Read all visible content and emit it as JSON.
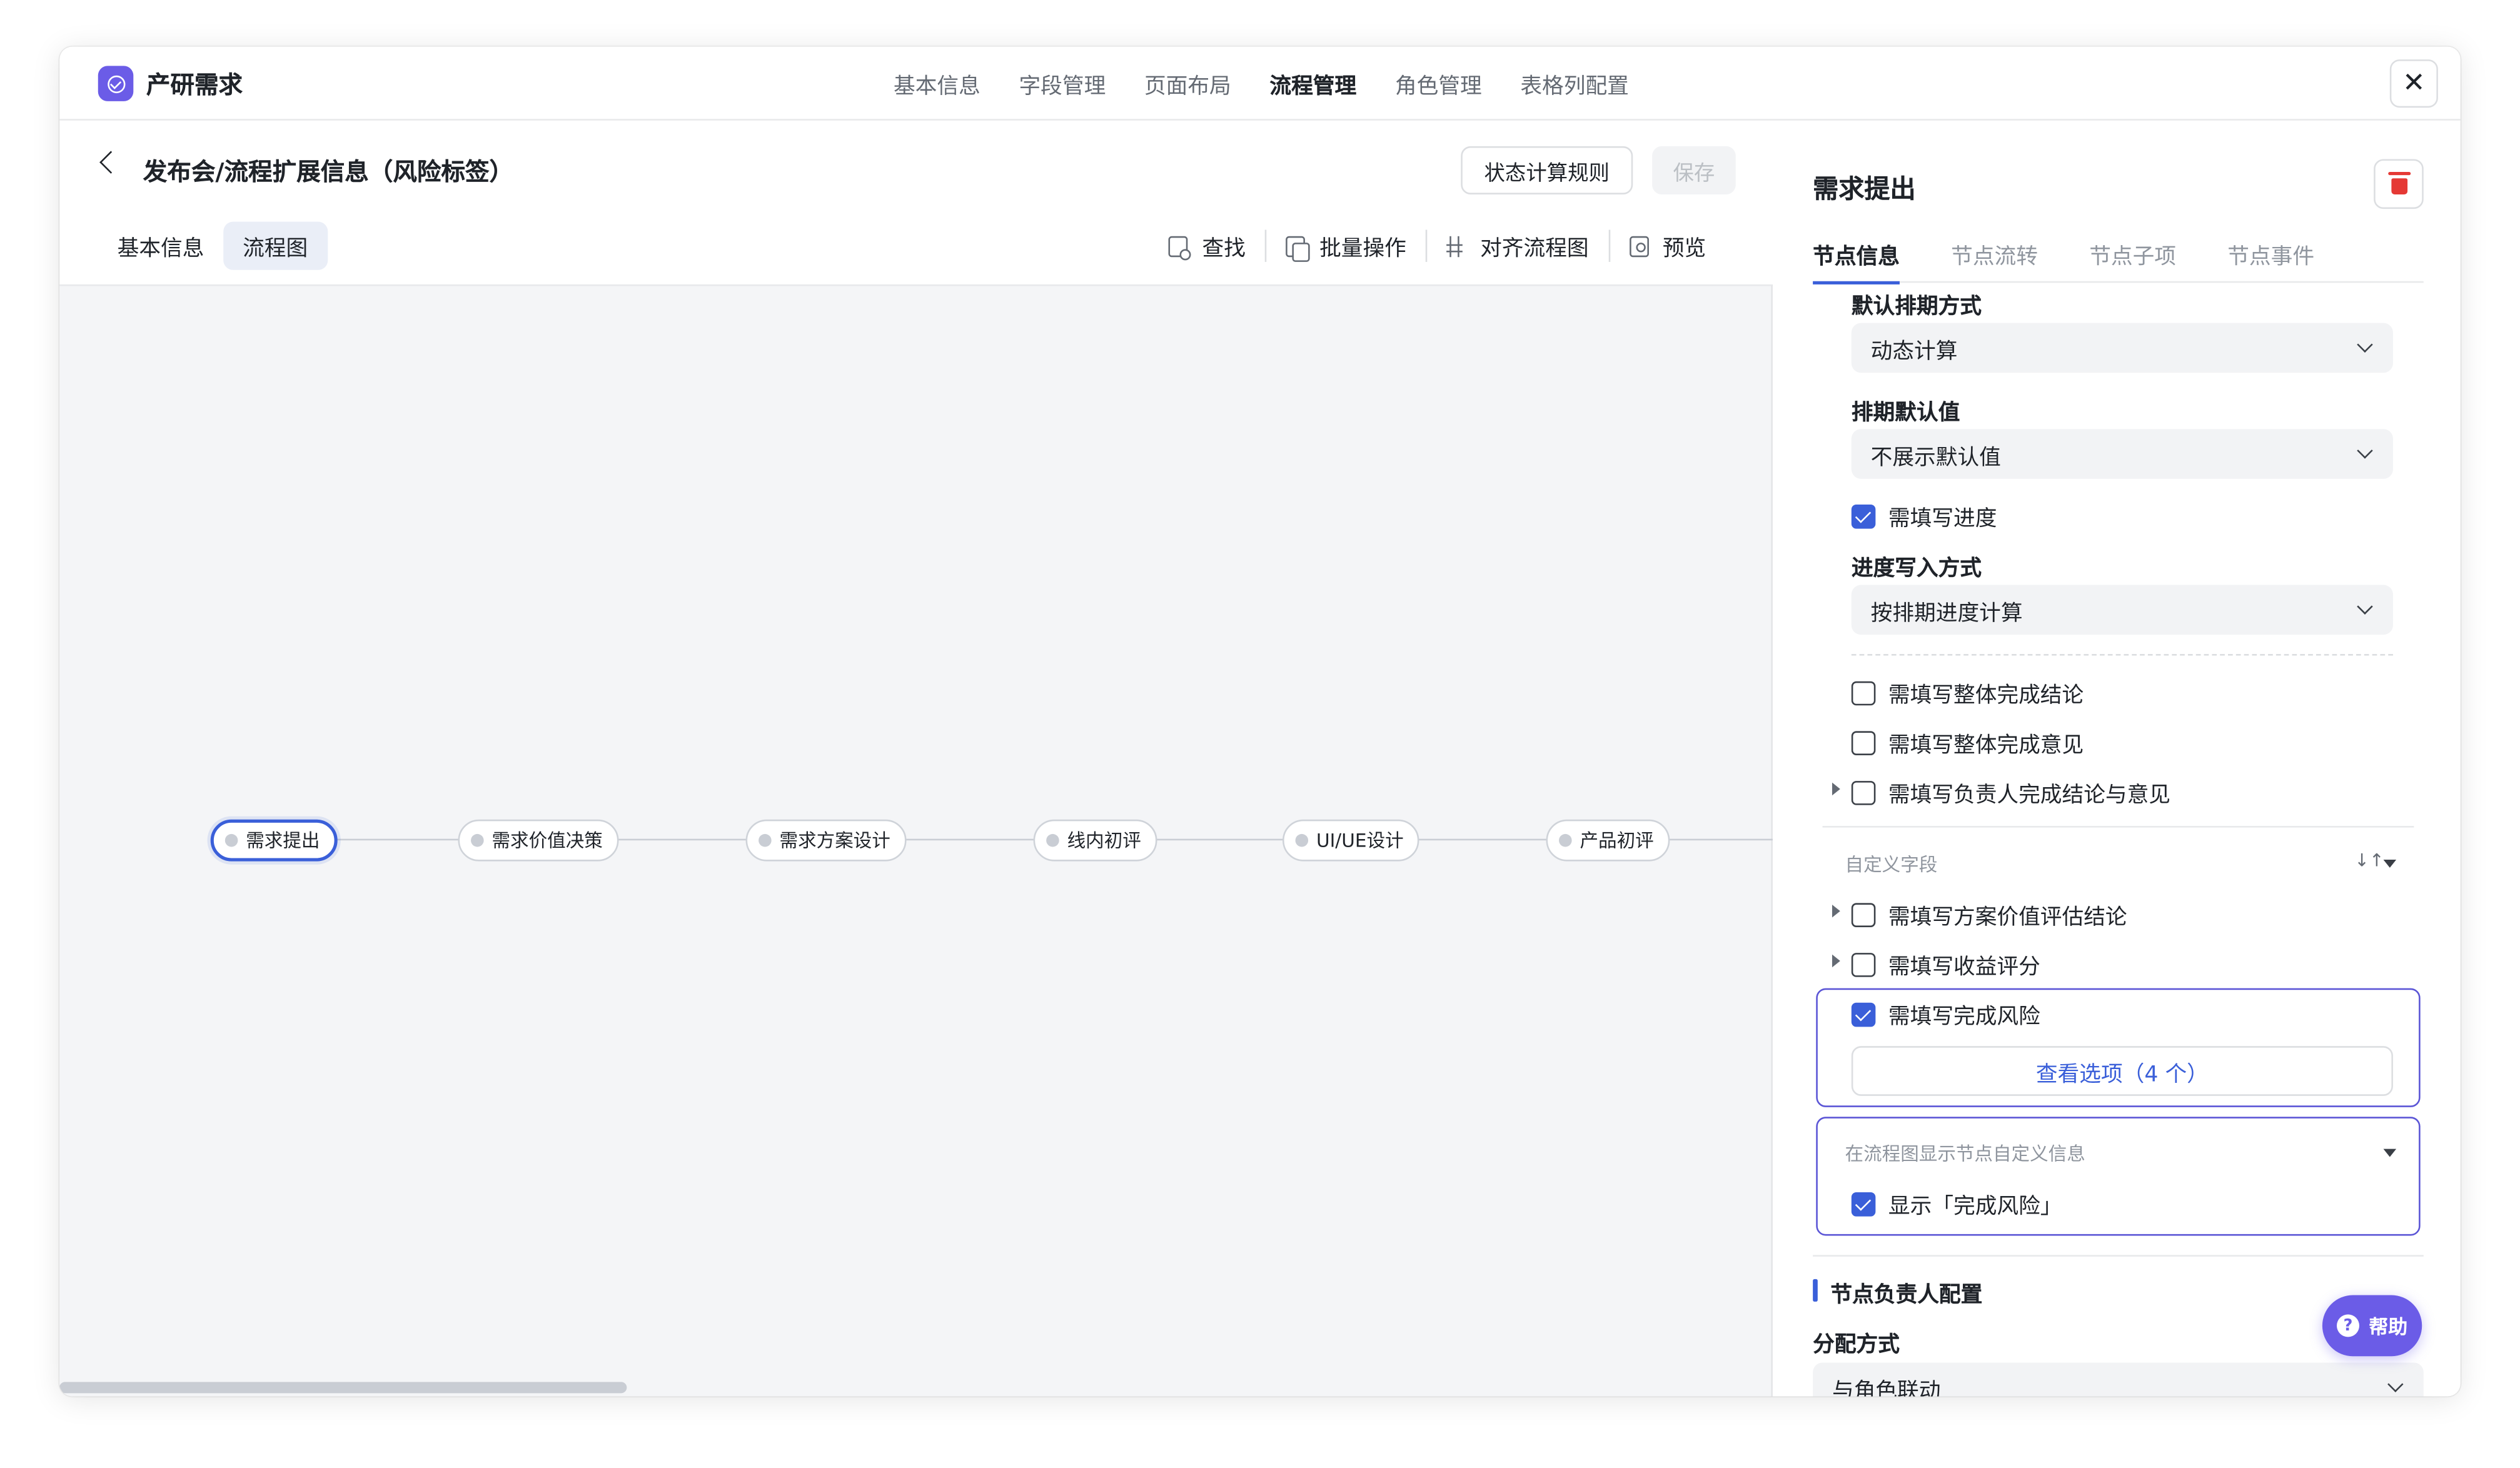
{
  "app": {
    "title": "产研需求",
    "close_glyph": "✕"
  },
  "top_tabs": [
    "基本信息",
    "字段管理",
    "页面布局",
    "流程管理",
    "角色管理",
    "表格列配置"
  ],
  "top_tab_active": "流程管理",
  "page": {
    "title": "发布会/流程扩展信息（风险标签）",
    "rule_button": "状态计算规则",
    "save_button": "保存",
    "sub_tabs": [
      "基本信息",
      "流程图"
    ],
    "toolbar": {
      "find": "查找",
      "batch": "批量操作",
      "align": "对齐流程图",
      "preview": "预览"
    }
  },
  "flow_nodes": [
    "需求提出",
    "需求价值决策",
    "需求方案设计",
    "线内初评",
    "UI/UE设计",
    "产品初评"
  ],
  "panel": {
    "title": "需求提出",
    "tabs": [
      "节点信息",
      "节点流转",
      "节点子项",
      "节点事件"
    ],
    "default_schedule_label": "默认排期方式",
    "default_schedule_value": "动态计算",
    "schedule_default_label": "排期默认值",
    "schedule_default_value": "不展示默认值",
    "need_progress": "需填写进度",
    "progress_mode_label": "进度写入方式",
    "progress_mode_value": "按排期进度计算",
    "need_overall_conclusion": "需填写整体完成结论",
    "need_overall_opinion": "需填写整体完成意见",
    "need_owner_conclusion": "需填写负责人完成结论与意见",
    "custom_fields_label": "自定义字段",
    "sort_glyph": "↓↑",
    "need_value_eval": "需填写方案价值评估结论",
    "need_revenue_score": "需填写收益评分",
    "need_risk": "需填写完成风险",
    "view_options": "查看选项（4 个）",
    "flow_display_label": "在流程图显示节点自定义信息",
    "show_risk": "显示「完成风险」",
    "owner_section": "节点负责人配置",
    "assign_label": "分配方式",
    "assign_value": "与角色联动"
  },
  "help": {
    "label": "帮助",
    "glyph": "?"
  },
  "colors": {
    "accent": "#3a5fd9",
    "brand": "#6b5ce7",
    "danger": "#e53935"
  }
}
